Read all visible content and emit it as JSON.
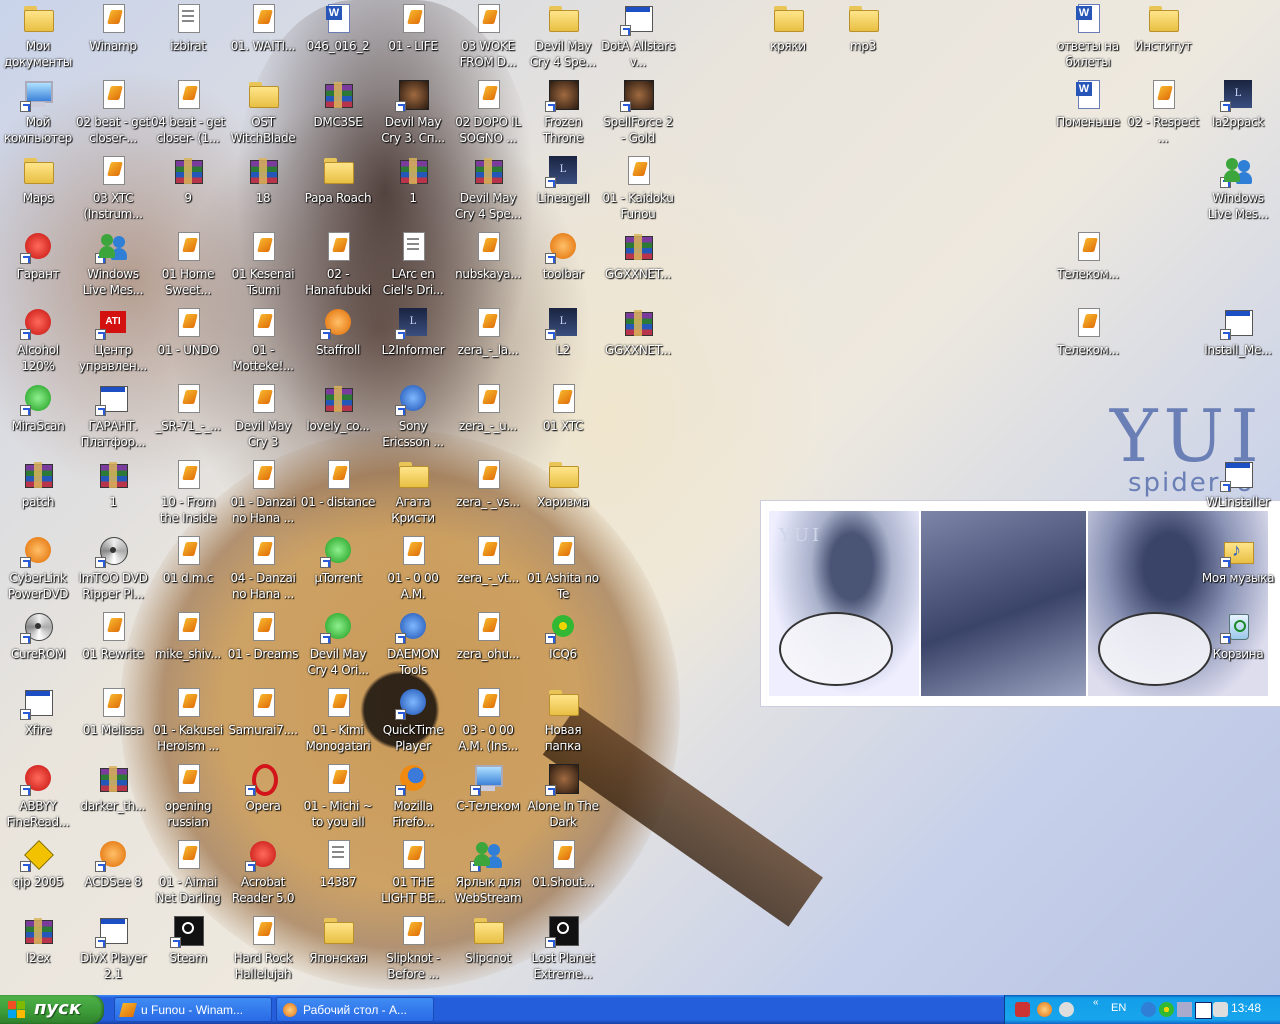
{
  "desktop": {
    "icons": [
      {
        "label": "Мои документы",
        "type": "folder"
      },
      {
        "label": "Мой компьютер",
        "type": "computer"
      },
      {
        "label": "Maps",
        "type": "folder"
      },
      {
        "label": "Гарант",
        "type": "red"
      },
      {
        "label": "Alcohol 120%",
        "type": "red"
      },
      {
        "label": "MiraScan",
        "type": "green"
      },
      {
        "label": "patch",
        "type": "rar"
      },
      {
        "label": "CyberLink PowerDVD",
        "type": "orange"
      },
      {
        "label": "CureROM",
        "type": "cd"
      },
      {
        "label": "Xfire",
        "type": "exe"
      },
      {
        "label": "ABBYY FineRead...",
        "type": "red"
      },
      {
        "label": "qip 2005",
        "type": "warn"
      },
      {
        "label": "l2ex",
        "type": "rar"
      },
      {
        "label": "Winamp",
        "type": "mp3"
      },
      {
        "label": "02 beat - get closer-...",
        "type": "mp3"
      },
      {
        "label": "03 XTC (Instrum...",
        "type": "mp3"
      },
      {
        "label": "Windows Live Mes...",
        "type": "people"
      },
      {
        "label": "Центр управлен...",
        "type": "ati"
      },
      {
        "label": "ГАРАНТ. Платфор...",
        "type": "exe"
      },
      {
        "label": "1",
        "type": "rar"
      },
      {
        "label": "ImTOO DVD Ripper Pl...",
        "type": "cd"
      },
      {
        "label": "01 Rewrite",
        "type": "mp3"
      },
      {
        "label": "01 Melissa",
        "type": "mp3"
      },
      {
        "label": "darker_th...",
        "type": "rar"
      },
      {
        "label": "ACDSee 8",
        "type": "orange"
      },
      {
        "label": "DivX Player 2.1",
        "type": "exe"
      },
      {
        "label": "izbirat",
        "type": "doc"
      },
      {
        "label": "04 beat - get closer- (1...",
        "type": "mp3"
      },
      {
        "label": "9",
        "type": "rar"
      },
      {
        "label": "01 Home Sweet...",
        "type": "mp3"
      },
      {
        "label": "01 - UNDO",
        "type": "mp3"
      },
      {
        "label": "_SR-71_-_...",
        "type": "mp3"
      },
      {
        "label": "10 - From the Inside",
        "type": "mp3"
      },
      {
        "label": "01 d.m.c",
        "type": "mp3"
      },
      {
        "label": "mike_shiv...",
        "type": "mp3"
      },
      {
        "label": "01 - Kakusei Heroism ...",
        "type": "mp3"
      },
      {
        "label": "opening russian",
        "type": "mp3"
      },
      {
        "label": "01 - Aimai Net Darling",
        "type": "mp3"
      },
      {
        "label": "Steam",
        "type": "steam"
      },
      {
        "label": "01. WAITI...",
        "type": "mp3"
      },
      {
        "label": "OST WitchBlade",
        "type": "folder"
      },
      {
        "label": "18",
        "type": "rar"
      },
      {
        "label": "01 Kesenai Tsumi",
        "type": "mp3"
      },
      {
        "label": "01 - Motteke!...",
        "type": "mp3"
      },
      {
        "label": "Devil May Cry 3",
        "type": "mp3"
      },
      {
        "label": "01 - Danzai no Hana ...",
        "type": "mp3"
      },
      {
        "label": "04 - Danzai no Hana ...",
        "type": "mp3"
      },
      {
        "label": "01 - Dreams",
        "type": "mp3"
      },
      {
        "label": "Samurai7....",
        "type": "mp3"
      },
      {
        "label": "Opera",
        "type": "opera"
      },
      {
        "label": "Acrobat Reader 5.0",
        "type": "red"
      },
      {
        "label": "Hard Rock Hallelujah",
        "type": "mp3"
      },
      {
        "label": "046_016_2",
        "type": "word"
      },
      {
        "label": "DMC3SE",
        "type": "rar"
      },
      {
        "label": "Papa Roach",
        "type": "folder"
      },
      {
        "label": "02 - Hanafubuki",
        "type": "mp3"
      },
      {
        "label": "Staffroll",
        "type": "orange"
      },
      {
        "label": "lovely_co...",
        "type": "rar"
      },
      {
        "label": "01 - distance",
        "type": "mp3"
      },
      {
        "label": "µTorrent",
        "type": "green"
      },
      {
        "label": "Devil May Cry 4 Ori...",
        "type": "green"
      },
      {
        "label": "01 - Kimi Monogatari",
        "type": "mp3"
      },
      {
        "label": "01 - Michi ~ to you all",
        "type": "mp3"
      },
      {
        "label": "14387",
        "type": "doc"
      },
      {
        "label": "Японская",
        "type": "folder"
      },
      {
        "label": "01 - LIFE",
        "type": "mp3"
      },
      {
        "label": "Devil May Cry 3. Сп...",
        "type": "game"
      },
      {
        "label": "1",
        "type": "rar"
      },
      {
        "label": "LArc en Ciel's Dri...",
        "type": "doc"
      },
      {
        "label": "L2Informer",
        "type": "lineage"
      },
      {
        "label": "Sony Ericsson ...",
        "type": "blue"
      },
      {
        "label": "Агата Кристи",
        "type": "folder"
      },
      {
        "label": "01 - 0 00 A.M.",
        "type": "mp3"
      },
      {
        "label": "DAEMON Tools",
        "type": "blue"
      },
      {
        "label": "QuickTime Player",
        "type": "blue"
      },
      {
        "label": "Mozilla Firefo...",
        "type": "firefox"
      },
      {
        "label": "01 THE LIGHT BE...",
        "type": "mp3"
      },
      {
        "label": "Slipknot - Before ...",
        "type": "mp3"
      },
      {
        "label": "03 WOKE FROM D...",
        "type": "mp3"
      },
      {
        "label": "02 DOPO IL SOGNO ...",
        "type": "mp3"
      },
      {
        "label": "Devil May Cry 4 Spe...",
        "type": "rar"
      },
      {
        "label": "nubskaya...",
        "type": "mp3"
      },
      {
        "label": "zera_-_la...",
        "type": "mp3"
      },
      {
        "label": "zera_-_u...",
        "type": "mp3"
      },
      {
        "label": "zera_-_vs...",
        "type": "mp3"
      },
      {
        "label": "zera_-_vt...",
        "type": "mp3"
      },
      {
        "label": "zera_ohu...",
        "type": "mp3"
      },
      {
        "label": "03 - 0 00 A.M. (Ins...",
        "type": "mp3"
      },
      {
        "label": "C-Телеком",
        "type": "computer"
      },
      {
        "label": "Ярлык для WebStream",
        "type": "people"
      },
      {
        "label": "Slipcnot",
        "type": "folder"
      },
      {
        "label": "Devil May Cry 4 Spe...",
        "type": "folder"
      },
      {
        "label": "Frozen Throne",
        "type": "game"
      },
      {
        "label": "LineageII",
        "type": "lineage"
      },
      {
        "label": "toolbar",
        "type": "orange"
      },
      {
        "label": "L2",
        "type": "lineage"
      },
      {
        "label": "01 XTC",
        "type": "mp3"
      },
      {
        "label": "Харизма",
        "type": "folder"
      },
      {
        "label": "01 Ashita no Te",
        "type": "mp3"
      },
      {
        "label": "ICQ6",
        "type": "flower"
      },
      {
        "label": "Новая папка",
        "type": "folder"
      },
      {
        "label": "Alone In The Dark",
        "type": "game"
      },
      {
        "label": "01.Shout...",
        "type": "mp3"
      },
      {
        "label": "Lost Planet Extreme...",
        "type": "steam"
      },
      {
        "label": "DotA Allstars v...",
        "type": "exe"
      },
      {
        "label": "SpellForce 2 - Gold",
        "type": "game"
      },
      {
        "label": "01 - Kaidoku Funou",
        "type": "mp3"
      },
      {
        "label": "GGXXNET...",
        "type": "rar"
      },
      {
        "label": "GGXXNET...",
        "type": "rar"
      },
      {
        "label": "кряки",
        "type": "folder"
      },
      {
        "label": "mp3",
        "type": "folder"
      },
      {
        "label": "ответы на билеты",
        "type": "word"
      },
      {
        "label": "Поменьше",
        "type": "word"
      },
      {
        "label": "Телеком...",
        "type": "mp3"
      },
      {
        "label": "Телеком...",
        "type": "mp3"
      },
      {
        "label": "Институт",
        "type": "folder"
      },
      {
        "label": "02 - Respect ...",
        "type": "mp3"
      },
      {
        "label": "la2ppack",
        "type": "lineage"
      },
      {
        "label": "Windows Live Mes...",
        "type": "people"
      },
      {
        "label": "Install_Me...",
        "type": "exe"
      },
      {
        "label": "WLinstaller",
        "type": "exe"
      },
      {
        "label": "Моя музыка",
        "type": "music"
      },
      {
        "label": "Корзина",
        "type": "recycle"
      }
    ]
  },
  "wallpaper": {
    "logo_text": "YUI",
    "logo_sub": "spider",
    "logo_sub_end": "o",
    "photo_caption": "YUI"
  },
  "taskbar": {
    "start_label": "пуск",
    "tasks": [
      {
        "label": "u Funou - Winam..."
      },
      {
        "label": "Рабочий стол - A..."
      }
    ],
    "tray": {
      "lang": "EN",
      "clock": "13:48"
    }
  },
  "colors": {
    "taskbar": "#245edb",
    "start": "#3c9a37",
    "tray": "#18a5ec"
  }
}
